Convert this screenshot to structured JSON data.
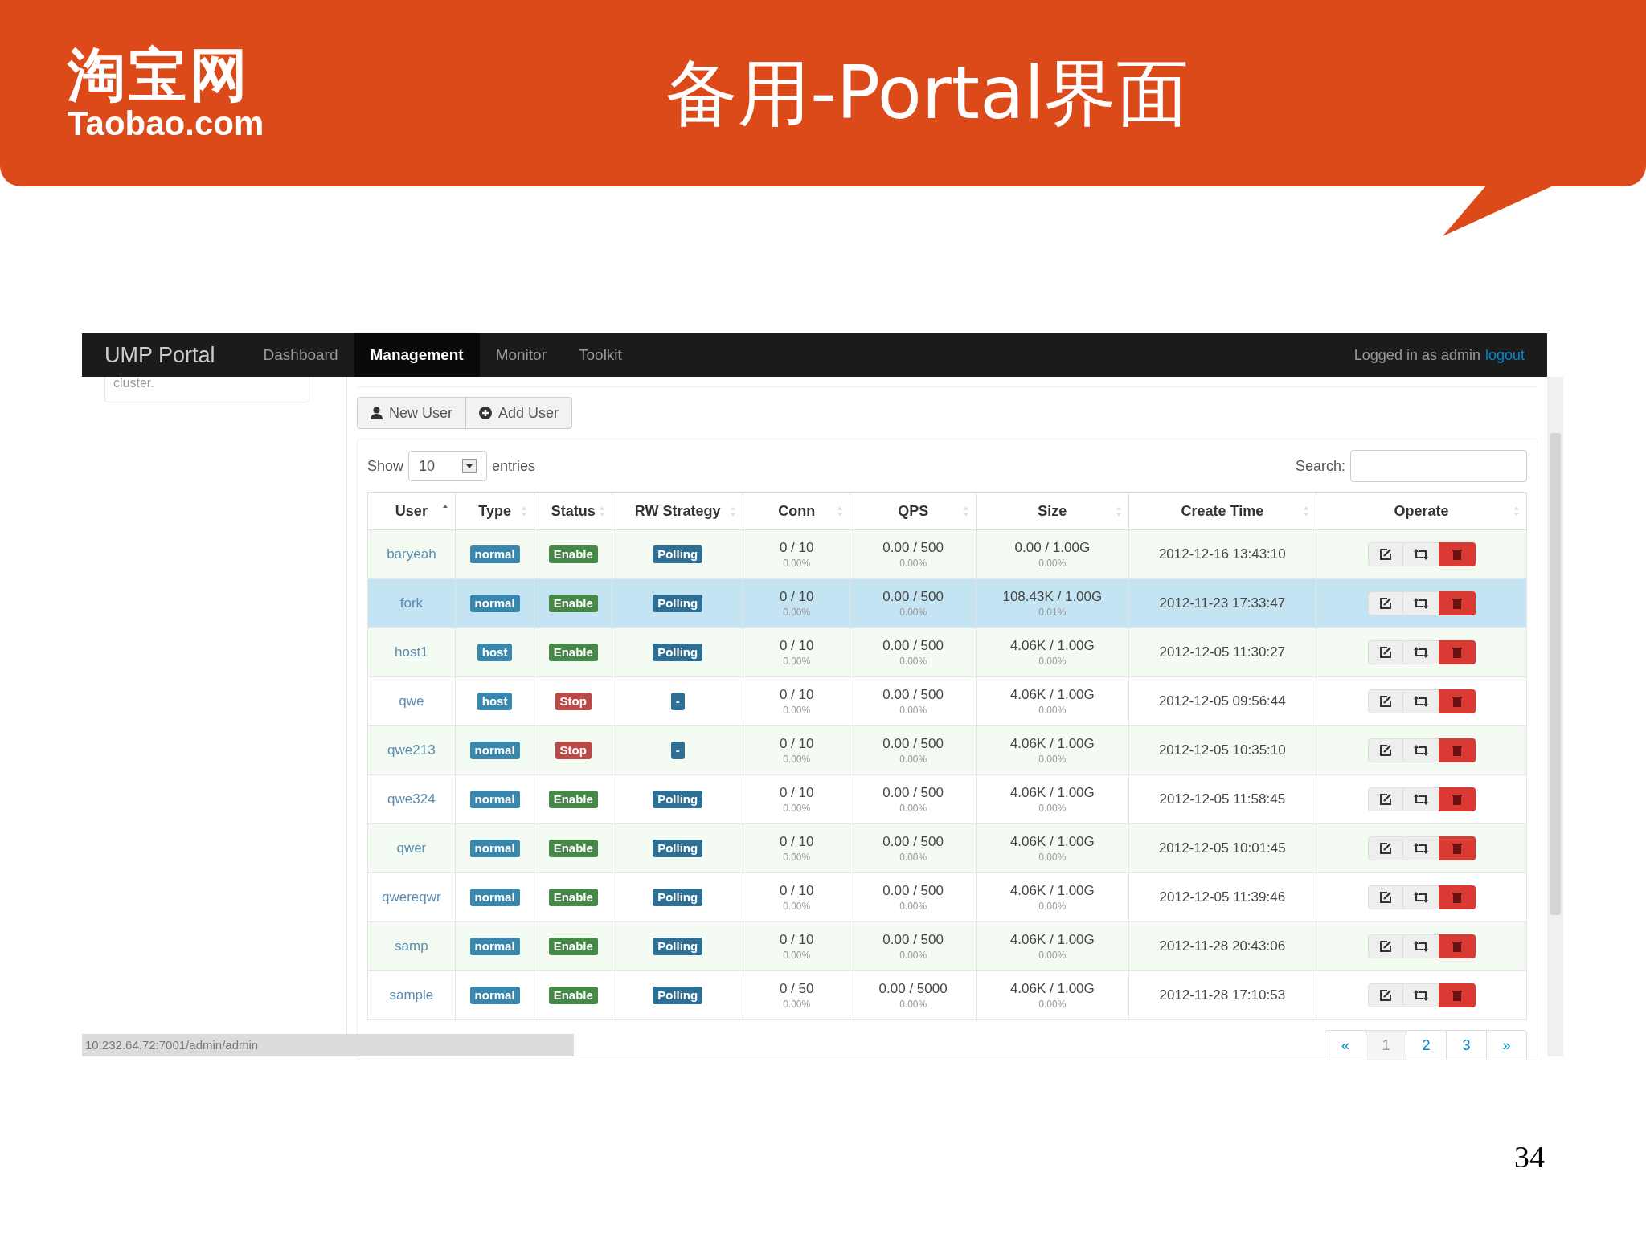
{
  "slide": {
    "logo": {
      "chinese": "淘宝网",
      "latin": "Taobao.com"
    },
    "title": "备用-Portal界面",
    "page_number": "34"
  },
  "navbar": {
    "brand": "UMP Portal",
    "tabs": [
      {
        "label": "Dashboard",
        "selected": false
      },
      {
        "label": "Management",
        "selected": true
      },
      {
        "label": "Monitor",
        "selected": false
      },
      {
        "label": "Toolkit",
        "selected": false
      }
    ],
    "login_text": "Logged in as admin",
    "logout": "logout"
  },
  "sidebar": {
    "text": "cluster."
  },
  "toolbar": {
    "buttons": [
      {
        "label": "New User"
      },
      {
        "label": "Add User"
      }
    ]
  },
  "table_controls": {
    "show": "Show",
    "page_size": "10",
    "entries": "entries",
    "search_label": "Search:"
  },
  "table": {
    "columns": [
      {
        "label": "User",
        "sorted": true
      },
      {
        "label": "Type",
        "sorted": false
      },
      {
        "label": "Status",
        "sorted": false
      },
      {
        "label": "RW Strategy",
        "sorted": false
      },
      {
        "label": "Conn",
        "sorted": false
      },
      {
        "label": "QPS",
        "sorted": false
      },
      {
        "label": "Size",
        "sorted": false
      },
      {
        "label": "Create Time",
        "sorted": false
      },
      {
        "label": "Operate",
        "sorted": false
      }
    ],
    "rows": [
      {
        "user": "baryeah",
        "type": {
          "label": "normal"
        },
        "status": {
          "label": "Enable",
          "kind": "enable"
        },
        "rw": "Polling",
        "conn": "0 / 10",
        "conn_pct": "0.00%",
        "qps": "0.00 / 500",
        "qps_pct": "0.00%",
        "size": "0.00 / 1.00G",
        "size_pct": "0.00%",
        "created": "2012-12-16 13:43:10",
        "selected": false
      },
      {
        "user": "fork",
        "type": {
          "label": "normal"
        },
        "status": {
          "label": "Enable",
          "kind": "enable"
        },
        "rw": "Polling",
        "conn": "0 / 10",
        "conn_pct": "0.00%",
        "qps": "0.00 / 500",
        "qps_pct": "0.00%",
        "size": "108.43K / 1.00G",
        "size_pct": "0.01%",
        "created": "2012-11-23 17:33:47",
        "selected": true
      },
      {
        "user": "host1",
        "type": {
          "label": "host"
        },
        "status": {
          "label": "Enable",
          "kind": "enable"
        },
        "rw": "Polling",
        "conn": "0 / 10",
        "conn_pct": "0.00%",
        "qps": "0.00 / 500",
        "qps_pct": "0.00%",
        "size": "4.06K / 1.00G",
        "size_pct": "0.00%",
        "created": "2012-12-05 11:30:27",
        "selected": false
      },
      {
        "user": "qwe",
        "type": {
          "label": "host"
        },
        "status": {
          "label": "Stop",
          "kind": "stop"
        },
        "rw": "-",
        "conn": "0 / 10",
        "conn_pct": "0.00%",
        "qps": "0.00 / 500",
        "qps_pct": "0.00%",
        "size": "4.06K / 1.00G",
        "size_pct": "0.00%",
        "created": "2012-12-05 09:56:44",
        "selected": false
      },
      {
        "user": "qwe213",
        "type": {
          "label": "normal"
        },
        "status": {
          "label": "Stop",
          "kind": "stop"
        },
        "rw": "-",
        "conn": "0 / 10",
        "conn_pct": "0.00%",
        "qps": "0.00 / 500",
        "qps_pct": "0.00%",
        "size": "4.06K / 1.00G",
        "size_pct": "0.00%",
        "created": "2012-12-05 10:35:10",
        "selected": false
      },
      {
        "user": "qwe324",
        "type": {
          "label": "normal"
        },
        "status": {
          "label": "Enable",
          "kind": "enable"
        },
        "rw": "Polling",
        "conn": "0 / 10",
        "conn_pct": "0.00%",
        "qps": "0.00 / 500",
        "qps_pct": "0.00%",
        "size": "4.06K / 1.00G",
        "size_pct": "0.00%",
        "created": "2012-12-05 11:58:45",
        "selected": false
      },
      {
        "user": "qwer",
        "type": {
          "label": "normal"
        },
        "status": {
          "label": "Enable",
          "kind": "enable"
        },
        "rw": "Polling",
        "conn": "0 / 10",
        "conn_pct": "0.00%",
        "qps": "0.00 / 500",
        "qps_pct": "0.00%",
        "size": "4.06K / 1.00G",
        "size_pct": "0.00%",
        "created": "2012-12-05 10:01:45",
        "selected": false
      },
      {
        "user": "qwereqwr",
        "type": {
          "label": "normal"
        },
        "status": {
          "label": "Enable",
          "kind": "enable"
        },
        "rw": "Polling",
        "conn": "0 / 10",
        "conn_pct": "0.00%",
        "qps": "0.00 / 500",
        "qps_pct": "0.00%",
        "size": "4.06K / 1.00G",
        "size_pct": "0.00%",
        "created": "2012-12-05 11:39:46",
        "selected": false
      },
      {
        "user": "samp",
        "type": {
          "label": "normal"
        },
        "status": {
          "label": "Enable",
          "kind": "enable"
        },
        "rw": "Polling",
        "conn": "0 / 10",
        "conn_pct": "0.00%",
        "qps": "0.00 / 500",
        "qps_pct": "0.00%",
        "size": "4.06K / 1.00G",
        "size_pct": "0.00%",
        "created": "2012-11-28 20:43:06",
        "selected": false
      },
      {
        "user": "sample",
        "type": {
          "label": "normal"
        },
        "status": {
          "label": "Enable",
          "kind": "enable"
        },
        "rw": "Polling",
        "conn": "0 / 50",
        "conn_pct": "0.00%",
        "qps": "0.00 / 5000",
        "qps_pct": "0.00%",
        "size": "4.06K / 1.00G",
        "size_pct": "0.00%",
        "created": "2012-11-28 17:10:53",
        "selected": false
      }
    ]
  },
  "pagination": [
    {
      "label": "«",
      "selected": false
    },
    {
      "label": "1",
      "selected": true
    },
    {
      "label": "2",
      "selected": false
    },
    {
      "label": "3",
      "selected": false
    },
    {
      "label": "»",
      "selected": false
    }
  ],
  "status_bar": {
    "url": "10.232.64.72:7001/admin/admin"
  }
}
